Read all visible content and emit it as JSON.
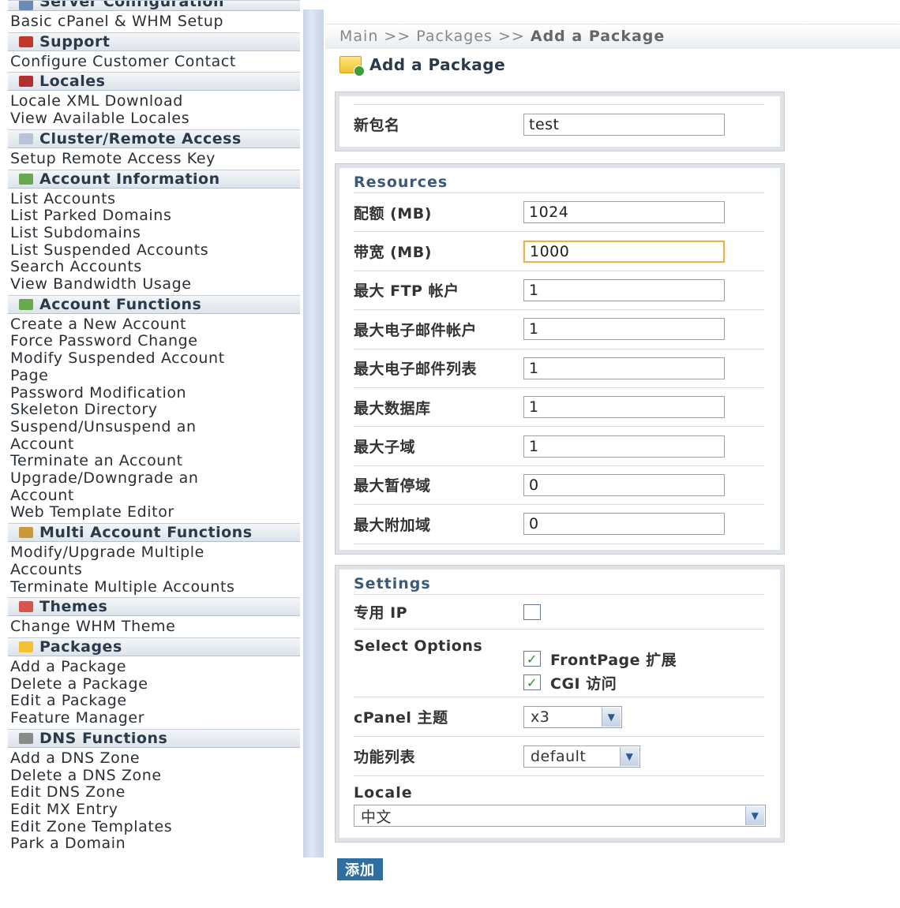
{
  "sidebar": {
    "top_section": "Server Configuration",
    "top_links": [
      "Basic cPanel & WHM Setup"
    ],
    "sections": [
      {
        "title": "Support",
        "icon": "support-icon",
        "color": "#c0392b",
        "links": [
          "Configure Customer Contact"
        ]
      },
      {
        "title": "Locales",
        "icon": "locales-icon",
        "color": "#b03030",
        "links": [
          "Locale XML Download",
          "View Available Locales"
        ]
      },
      {
        "title": "Cluster/Remote Access",
        "icon": "cluster-icon",
        "color": "#b8c4d4",
        "links": [
          "Setup Remote Access Key"
        ]
      },
      {
        "title": "Account Information",
        "icon": "account-info-icon",
        "color": "#6aa84f",
        "links": [
          "List Accounts",
          "List Parked Domains",
          "List Subdomains",
          "List Suspended Accounts",
          "Search Accounts",
          "View Bandwidth Usage"
        ]
      },
      {
        "title": "Account Functions",
        "icon": "account-functions-icon",
        "color": "#6aa84f",
        "links": [
          "Create a New Account",
          "Force Password Change",
          "Modify Suspended Account Page",
          "Password Modification",
          "Skeleton Directory",
          "Suspend/Unsuspend an Account",
          "Terminate an Account",
          "Upgrade/Downgrade an Account",
          "Web Template Editor"
        ]
      },
      {
        "title": "Multi Account Functions",
        "icon": "multi-account-icon",
        "color": "#c89a3a",
        "links": [
          "Modify/Upgrade Multiple Accounts",
          "Terminate Multiple Accounts"
        ]
      },
      {
        "title": "Themes",
        "icon": "themes-icon",
        "color": "#d9534f",
        "links": [
          "Change WHM Theme"
        ]
      },
      {
        "title": "Packages",
        "icon": "packages-icon",
        "color": "#f2c230",
        "links": [
          "Add a Package",
          "Delete a Package",
          "Edit a Package",
          "Feature Manager"
        ]
      },
      {
        "title": "DNS Functions",
        "icon": "dns-icon",
        "color": "#8a8a8a",
        "links": [
          "Add a DNS Zone",
          "Delete a DNS Zone",
          "Edit DNS Zone",
          "Edit MX Entry",
          "Edit Zone Templates",
          "Park a Domain"
        ]
      }
    ]
  },
  "breadcrumb": {
    "prefix": "Main >> Packages >> ",
    "current": "Add a Package"
  },
  "page_title": "Add a Package",
  "package_name": {
    "label": "新包名",
    "value": "test"
  },
  "resources": {
    "title": "Resources",
    "fields": [
      {
        "label": "配额 (MB)",
        "value": "1024"
      },
      {
        "label": "带宽 (MB)",
        "value": "1000"
      },
      {
        "label": "最大 FTP 帐户",
        "value": "1"
      },
      {
        "label": "最大电子邮件帐户",
        "value": "1"
      },
      {
        "label": "最大电子邮件列表",
        "value": "1"
      },
      {
        "label": "最大数据库",
        "value": "1"
      },
      {
        "label": "最大子域",
        "value": "1"
      },
      {
        "label": "最大暂停域",
        "value": "0"
      },
      {
        "label": "最大附加域",
        "value": "0"
      }
    ]
  },
  "settings": {
    "title": "Settings",
    "dedicated_ip_label": "专用 IP",
    "select_options_label": "Select Options",
    "options": [
      {
        "label": "FrontPage 扩展",
        "checked": true
      },
      {
        "label": "CGI 访问",
        "checked": true
      }
    ],
    "cpanel_theme_label": "cPanel 主题",
    "cpanel_theme_value": "x3",
    "feature_list_label": "功能列表",
    "feature_list_value": "default",
    "locale_label": "Locale",
    "locale_value": "中文"
  },
  "add_button": "添加"
}
